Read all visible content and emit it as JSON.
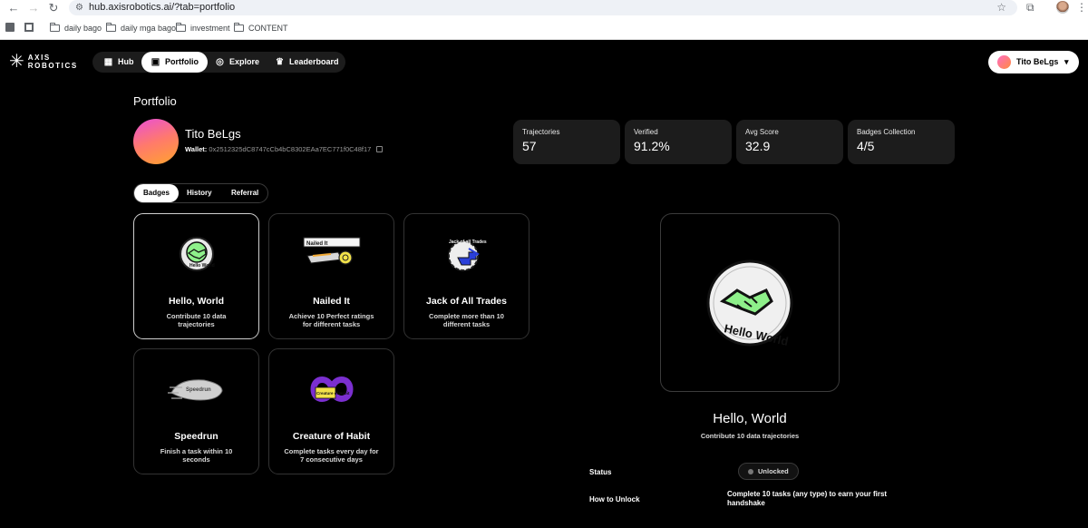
{
  "browser": {
    "url": "hub.axisrobotics.ai/?tab=portfolio",
    "bookmarks": [
      "daily bago",
      "daily mga bago",
      "investment",
      "CONTENT"
    ]
  },
  "header": {
    "logo": "AXIS ROBOTICS",
    "nav": [
      {
        "label": "Hub",
        "icon": "hub-grid-icon"
      },
      {
        "label": "Portfolio",
        "icon": "portfolio-chart-icon"
      },
      {
        "label": "Explore",
        "icon": "compass-icon"
      },
      {
        "label": "Leaderboard",
        "icon": "trophy-icon"
      }
    ],
    "active_nav": "Portfolio",
    "user": {
      "name": "Tito BeLgs"
    }
  },
  "page": {
    "title": "Portfolio",
    "profile": {
      "name": "Tito BeLgs",
      "wallet_label": "Wallet:",
      "wallet_address": "0x2512325dC8747cCb4bC8302EAa7EC771f0C48f17"
    },
    "stats": [
      {
        "label": "Trajectories",
        "value": "57"
      },
      {
        "label": "Verified",
        "value": "91.2%"
      },
      {
        "label": "Avg Score",
        "value": "32.9"
      },
      {
        "label": "Badges Collection",
        "value": "4/5"
      }
    ],
    "tabs": [
      "Badges",
      "History",
      "Referral"
    ],
    "active_tab": "Badges",
    "badges": [
      {
        "title": "Hello, World",
        "desc": "Contribute 10 data trajectories",
        "art_text": "Hello World"
      },
      {
        "title": "Nailed It",
        "desc": "Achieve 10 Perfect ratings for different tasks",
        "art_text": "Nailed It"
      },
      {
        "title": "Jack of All Trades",
        "desc": "Complete more than 10 different tasks",
        "art_text": "Jack of all Trades"
      },
      {
        "title": "Speedrun",
        "desc": "Finish a task within 10 seconds",
        "art_text": "Speedrun"
      },
      {
        "title": "Creature of Habit",
        "desc": "Complete tasks every day for 7 consecutive days",
        "art_text": "Creature of Habit"
      }
    ],
    "selected_badge": {
      "title": "Hello, World",
      "desc": "Contribute 10 data trajectories",
      "art_text": "Hello World",
      "status_label": "Status",
      "status": "Unlocked",
      "unlock_label": "How to Unlock",
      "unlock_text": "Complete 10 tasks (any type) to earn your first handshake"
    }
  },
  "colors": {
    "background": "#000000",
    "card": "#1c1c1c",
    "hello_world_green": "#8ef08a",
    "habit_purple": "#7b2fd0"
  }
}
